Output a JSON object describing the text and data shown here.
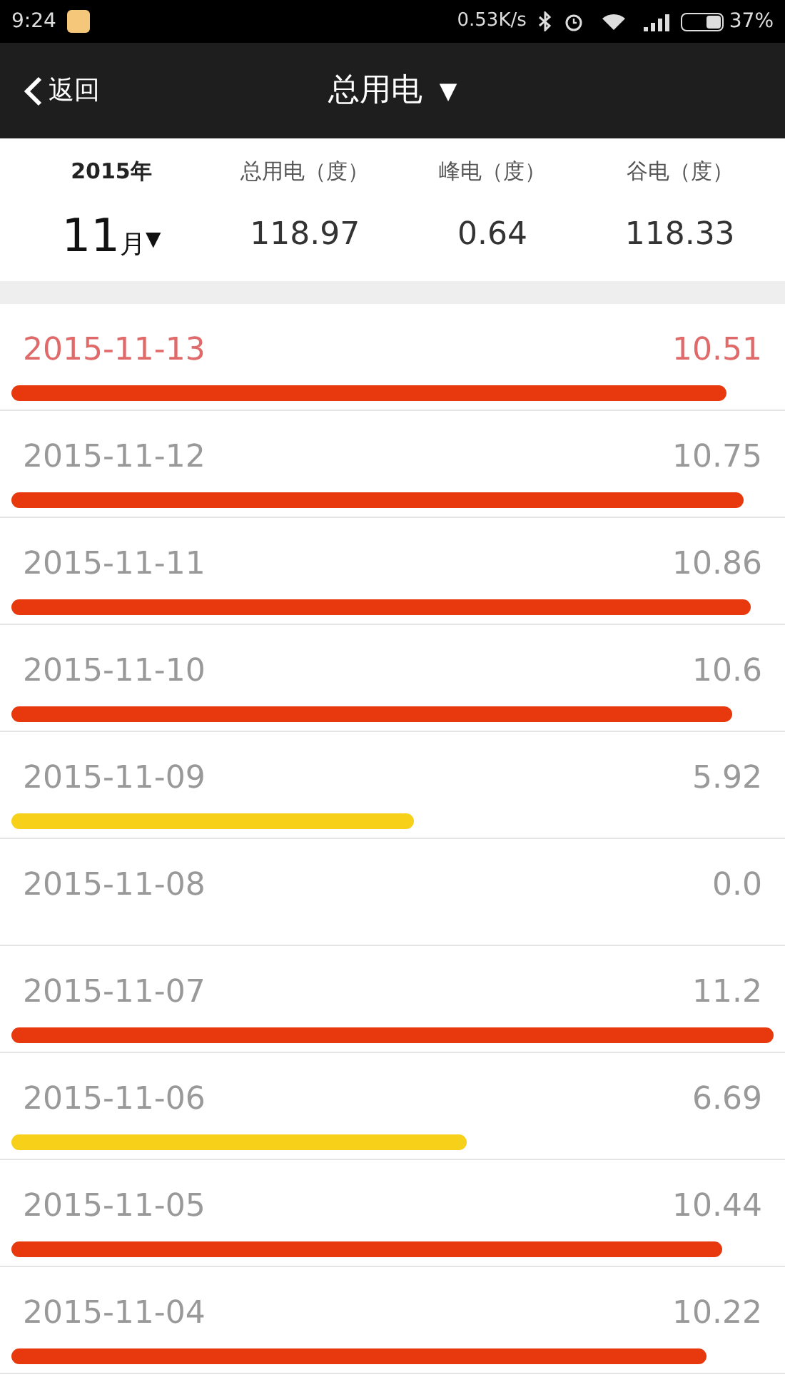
{
  "status_bar": {
    "time": "9:24",
    "speed": "0.53K/s",
    "battery": "37%"
  },
  "nav": {
    "back": "返回",
    "title": "总用电",
    "dropdown_mark": "▼"
  },
  "summary": {
    "year": "2015年",
    "month": "11",
    "month_unit": "月",
    "month_mark": "▼",
    "columns": [
      {
        "label": "总用电（度）",
        "value": "118.97"
      },
      {
        "label": "峰电（度）",
        "value": "0.64"
      },
      {
        "label": "谷电（度）",
        "value": "118.33"
      }
    ]
  },
  "days": [
    {
      "date": "2015-11-13",
      "value": "10.51",
      "color": "#e8380d",
      "selected": true
    },
    {
      "date": "2015-11-12",
      "value": "10.75",
      "color": "#e8380d",
      "selected": false
    },
    {
      "date": "2015-11-11",
      "value": "10.86",
      "color": "#e8380d",
      "selected": false
    },
    {
      "date": "2015-11-10",
      "value": "10.6",
      "color": "#e8380d",
      "selected": false
    },
    {
      "date": "2015-11-09",
      "value": "5.92",
      "color": "#f7d01a",
      "selected": false
    },
    {
      "date": "2015-11-08",
      "value": "0.0",
      "selected": false
    },
    {
      "date": "2015-11-07",
      "value": "11.2",
      "color": "#e8380d",
      "selected": false
    },
    {
      "date": "2015-11-06",
      "value": "6.69",
      "color": "#f7d01a",
      "selected": false
    },
    {
      "date": "2015-11-05",
      "value": "10.44",
      "color": "#e8380d",
      "selected": false
    },
    {
      "date": "2015-11-04",
      "value": "10.22",
      "color": "#e8380d",
      "selected": false
    }
  ]
}
